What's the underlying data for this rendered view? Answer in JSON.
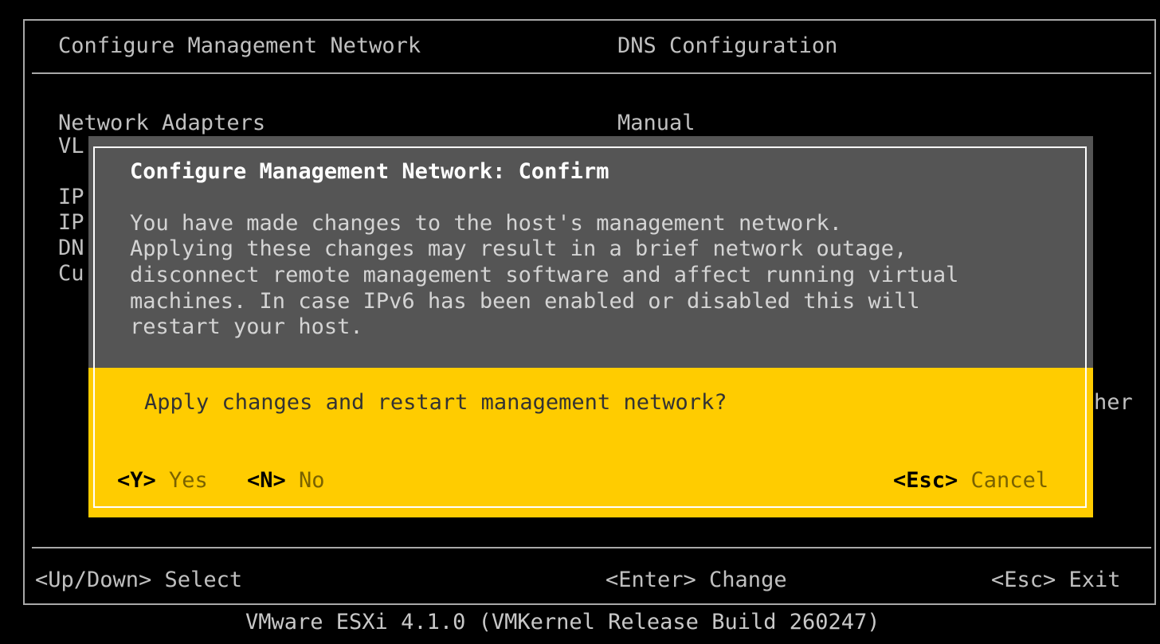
{
  "background": {
    "left_header_title": "Configure Management Network",
    "right_header_title": "DNS Configuration",
    "left_items": [
      "Network Adapters",
      "VL",
      "IP",
      "IP",
      "DN",
      "Cu"
    ],
    "right_value": "Manual",
    "right_partial_text": "her"
  },
  "dialog": {
    "title": "Configure Management Network: Confirm",
    "message_lines": [
      "You have made changes to the host's management network.",
      "Applying these changes may result in a brief network outage,",
      "disconnect remote management software and affect running virtual",
      "machines. In case IPv6 has been enabled or disabled this will",
      "restart your host."
    ],
    "question": "Apply changes and restart management network?",
    "yes_key": "<Y>",
    "yes_label": "Yes",
    "no_key": "<N>",
    "no_label": "No",
    "cancel_key": "<Esc>",
    "cancel_label": "Cancel"
  },
  "footer": {
    "select_hint": "<Up/Down> Select",
    "change_hint": "<Enter> Change",
    "exit_hint": "<Esc> Exit"
  },
  "version": "VMware ESXi 4.1.0 (VMKernel Release Build 260247)",
  "colors": {
    "background": "#000000",
    "dialog_gray": "#555555",
    "dialog_yellow": "#ffcc00",
    "text_gray": "#c0c0c0"
  }
}
